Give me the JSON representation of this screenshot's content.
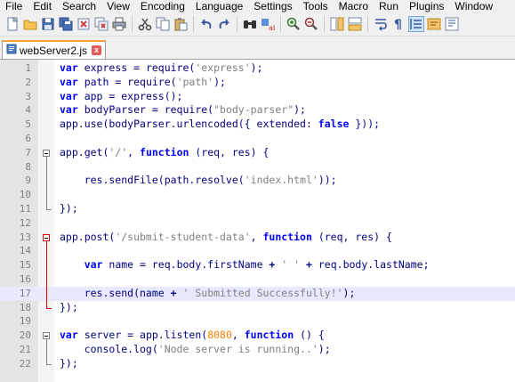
{
  "menu": [
    "File",
    "Edit",
    "Search",
    "View",
    "Encoding",
    "Language",
    "Settings",
    "Tools",
    "Macro",
    "Run",
    "Plugins",
    "Window"
  ],
  "toolbar": {
    "buttons": [
      "new-file-icon",
      "open-file-icon",
      "save-icon",
      "save-all-icon",
      "close-icon",
      "close-all-icon",
      "print-icon",
      "cut-icon",
      "copy-icon",
      "paste-icon",
      "undo-icon",
      "redo-icon",
      "find-icon",
      "replace-icon",
      "zoom-in-icon",
      "zoom-out-icon",
      "sync-vertical-icon",
      "sync-horizontal-icon",
      "word-wrap-icon",
      "show-all-characters-icon",
      "indent-guide-icon",
      "user-language-icon",
      "function-list-icon"
    ]
  },
  "tab": {
    "title": "webServer2.js",
    "close_label": "x"
  },
  "editor": {
    "current_line": 17,
    "lines": [
      {
        "num": "1",
        "tokens": [
          [
            "kw",
            "var"
          ],
          [
            "t",
            " express = require("
          ],
          [
            "str",
            "'express'"
          ],
          [
            "t",
            ");"
          ]
        ]
      },
      {
        "num": "2",
        "tokens": [
          [
            "kw",
            "var"
          ],
          [
            "t",
            " path = require("
          ],
          [
            "str",
            "'path'"
          ],
          [
            "t",
            ");"
          ]
        ]
      },
      {
        "num": "3",
        "tokens": [
          [
            "kw",
            "var"
          ],
          [
            "t",
            " app = express();"
          ]
        ]
      },
      {
        "num": "4",
        "tokens": [
          [
            "kw",
            "var"
          ],
          [
            "t",
            " bodyParser = require("
          ],
          [
            "str",
            "\"body-parser\""
          ],
          [
            "t",
            ");"
          ]
        ]
      },
      {
        "num": "5",
        "tokens": [
          [
            "t",
            "app.use(bodyParser.urlencoded({ extended: "
          ],
          [
            "kw",
            "false"
          ],
          [
            "t",
            " }));"
          ]
        ]
      },
      {
        "num": "6",
        "tokens": []
      },
      {
        "num": "7",
        "tokens": [
          [
            "t",
            "app.get("
          ],
          [
            "str",
            "'/'"
          ],
          [
            "t",
            ", "
          ],
          [
            "kw",
            "function"
          ],
          [
            "t",
            " (req, res) {"
          ]
        ]
      },
      {
        "num": "8",
        "tokens": []
      },
      {
        "num": "9",
        "tokens": [
          [
            "t",
            "    res.sendFile(path.resolve("
          ],
          [
            "str",
            "'index.html'"
          ],
          [
            "t",
            "));"
          ]
        ]
      },
      {
        "num": "10",
        "tokens": []
      },
      {
        "num": "11",
        "tokens": [
          [
            "t",
            "});"
          ]
        ]
      },
      {
        "num": "12",
        "tokens": []
      },
      {
        "num": "13",
        "tokens": [
          [
            "t",
            "app.post("
          ],
          [
            "str",
            "'/submit-student-data'"
          ],
          [
            "t",
            ", "
          ],
          [
            "kw",
            "function"
          ],
          [
            "t",
            " (req, res) {"
          ]
        ]
      },
      {
        "num": "14",
        "tokens": []
      },
      {
        "num": "15",
        "tokens": [
          [
            "t",
            "    "
          ],
          [
            "kw",
            "var"
          ],
          [
            "t",
            " name = req.body.firstName "
          ],
          [
            "op",
            "+"
          ],
          [
            "t",
            " "
          ],
          [
            "str",
            "' '"
          ],
          [
            "t",
            " "
          ],
          [
            "op",
            "+"
          ],
          [
            "t",
            " req.body.lastName;"
          ]
        ]
      },
      {
        "num": "16",
        "tokens": []
      },
      {
        "num": "17",
        "tokens": [
          [
            "t",
            "    res.send(name "
          ],
          [
            "op",
            "+"
          ],
          [
            "t",
            " "
          ],
          [
            "str",
            "' Submitted Successfully!'"
          ],
          [
            "t",
            ");"
          ]
        ]
      },
      {
        "num": "18",
        "tokens": [
          [
            "t",
            "});"
          ]
        ]
      },
      {
        "num": "19",
        "tokens": []
      },
      {
        "num": "20",
        "tokens": [
          [
            "kw",
            "var"
          ],
          [
            "t",
            " server = app.listen("
          ],
          [
            "num",
            "8080"
          ],
          [
            "t",
            ", "
          ],
          [
            "kw",
            "function"
          ],
          [
            "t",
            " () {"
          ]
        ]
      },
      {
        "num": "21",
        "tokens": [
          [
            "t",
            "    console.log("
          ],
          [
            "str",
            "'Node server is running..'"
          ],
          [
            "t",
            ");"
          ]
        ]
      },
      {
        "num": "22",
        "tokens": [
          [
            "t",
            "});"
          ]
        ]
      }
    ]
  },
  "colors": {
    "keyword": "#0000ff",
    "string": "#808080",
    "number": "#ff8000",
    "identifier": "#000080",
    "current_line": "#e8e8ff",
    "fold_active": "#e00000",
    "tab_accent": "#f7a33b"
  }
}
